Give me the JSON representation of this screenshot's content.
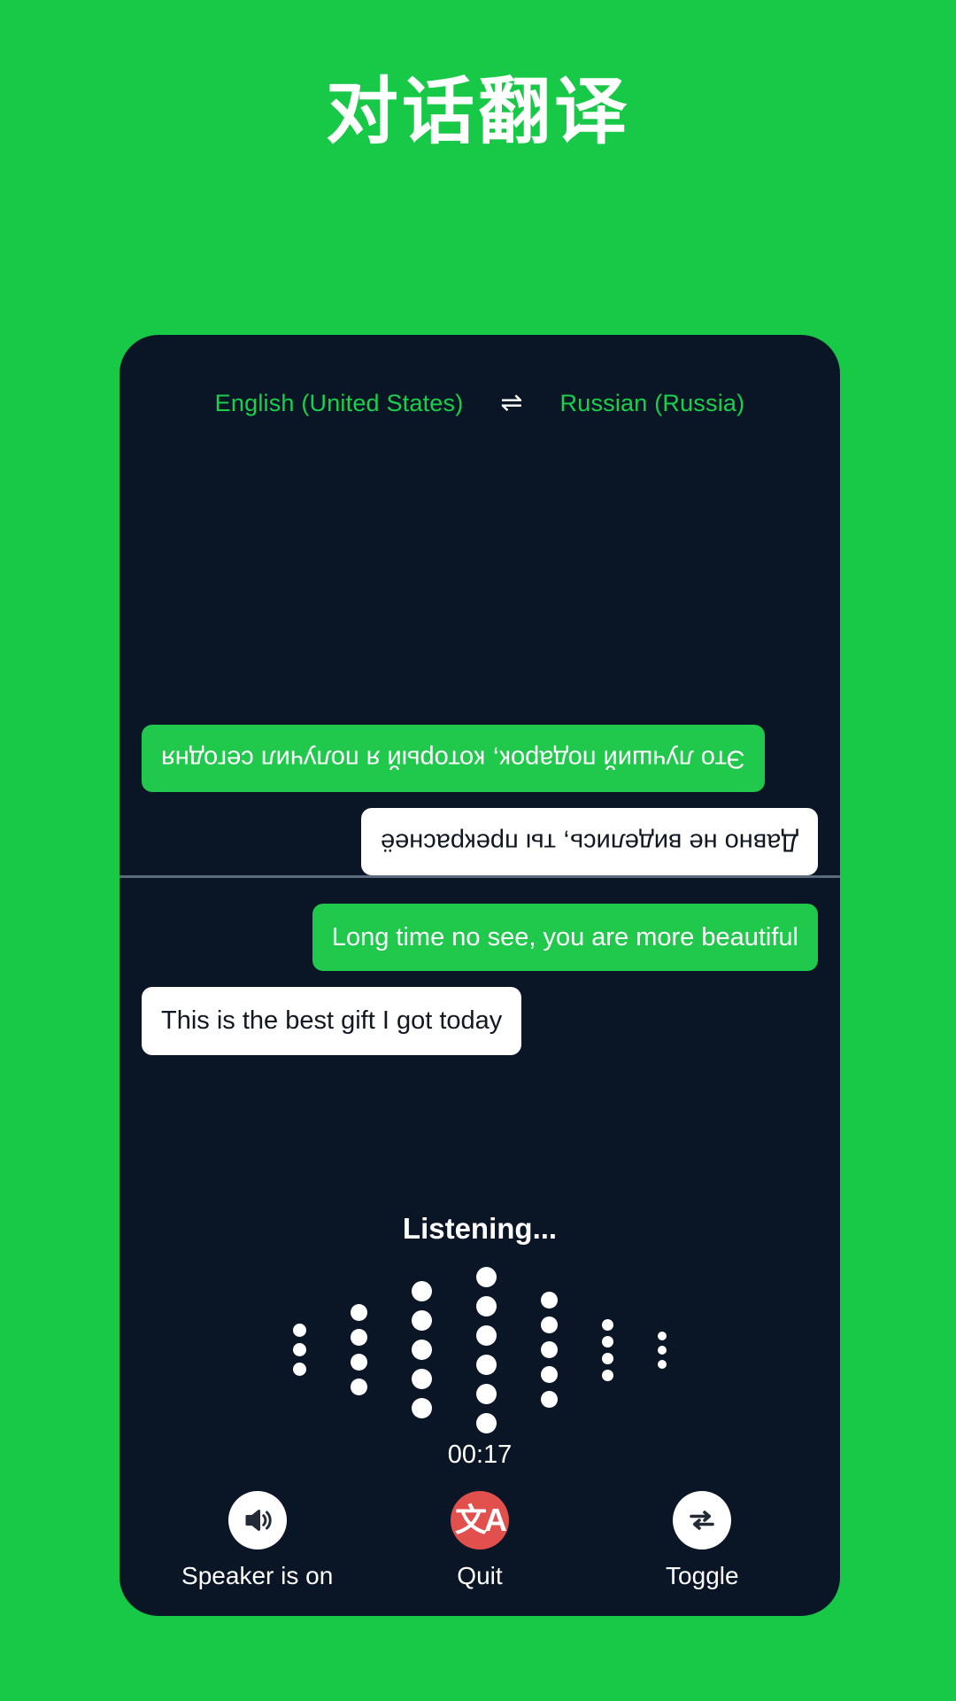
{
  "header": {
    "title": "对话翻译"
  },
  "languages": {
    "source": "English (United States)",
    "swap_icon": "⇌",
    "target": "Russian (Russia)"
  },
  "conversation": {
    "remote_panel": [
      {
        "text": "Это лучший подарок, который я получил сегодня",
        "style": "green",
        "align": "left",
        "flipped": true
      },
      {
        "text": "Давно не виделись, ты прекраснеё",
        "style": "white",
        "align": "right",
        "flipped": true
      }
    ],
    "local_panel": [
      {
        "text": "Long time no see, you are more beautiful",
        "style": "green",
        "align": "right",
        "flipped": false
      },
      {
        "text": "This is the best gift I got today",
        "style": "white",
        "align": "left",
        "flipped": false
      }
    ]
  },
  "status": {
    "listening_label": "Listening...",
    "timer": "00:17"
  },
  "waveform": {
    "columns": [
      {
        "dots": 3,
        "size": 15
      },
      {
        "dots": 4,
        "size": 19
      },
      {
        "dots": 5,
        "size": 23
      },
      {
        "dots": 6,
        "size": 23
      },
      {
        "dots": 5,
        "size": 19
      },
      {
        "dots": 4,
        "size": 13
      },
      {
        "dots": 3,
        "size": 10
      }
    ],
    "dot_color": "#FFFFFF"
  },
  "controls": [
    {
      "label": "Speaker is on",
      "icon": "speaker-on-icon",
      "circle": "white"
    },
    {
      "label": "Quit",
      "icon": "translate-icon",
      "circle": "red",
      "glyph": "文A"
    },
    {
      "label": "Toggle",
      "icon": "repeat-swap-icon",
      "circle": "white"
    }
  ],
  "colors": {
    "background_green": "#17C947",
    "card_dark": "#0A1626",
    "bubble_green": "#20C94C",
    "bubble_white": "#FFFFFF",
    "accent_red": "#E2504D",
    "language_green": "#19D04A",
    "divider": "#5C6B7C"
  }
}
